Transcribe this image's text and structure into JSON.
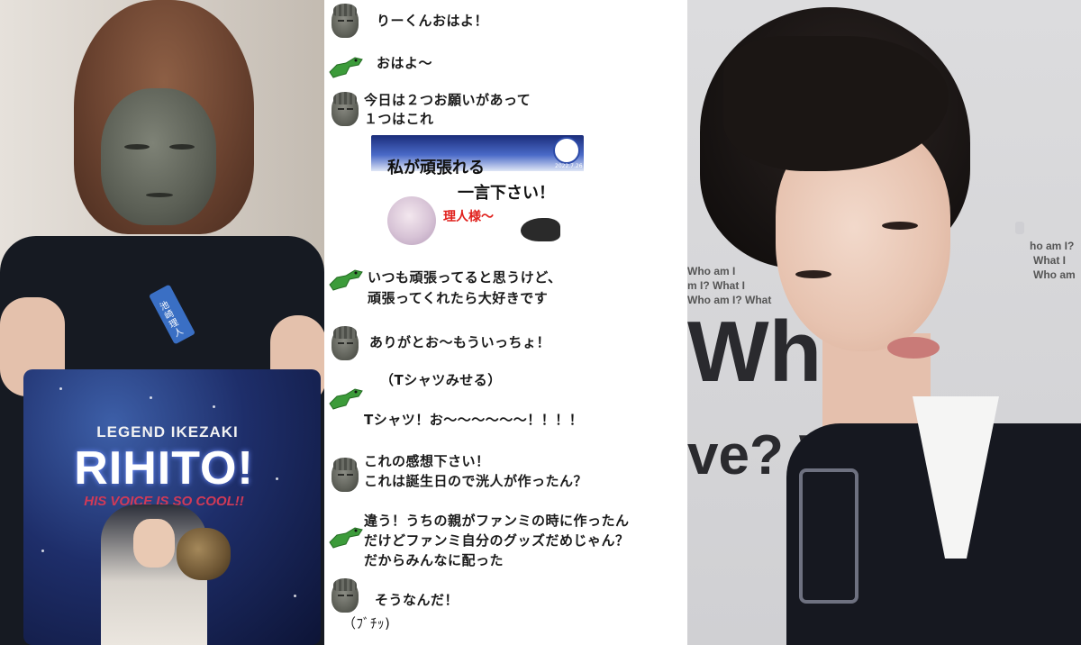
{
  "left_photo": {
    "shirt_legend": "LEGEND IKEZAKI",
    "shirt_name": "RIHITO!",
    "shirt_tagline": "HIS VOICE IS SO COOL!!",
    "name_tag": "池崎理人"
  },
  "chat": {
    "messages": [
      {
        "speaker": "buddha-icon",
        "lines": [
          "りーくんおはよ！"
        ]
      },
      {
        "speaker": "crocodile-icon",
        "lines": [
          "おはよ～"
        ]
      },
      {
        "speaker": "buddha-icon",
        "lines": [
          "今日は２つお願いがあって",
          "１つはこれ"
        ]
      },
      {
        "speaker": "crocodile-icon",
        "lines": [
          "いつも頑張ってると思うけど、",
          "頑張ってくれたら大好きです"
        ]
      },
      {
        "speaker": "buddha-icon",
        "lines": [
          "ありがとお～もういっちょ！"
        ]
      },
      {
        "speaker": "crocodile-icon",
        "lines": [
          "（Tシャツみせる）",
          "Tシャツ！お～～～～～～！！！！"
        ]
      },
      {
        "speaker": "buddha-icon",
        "lines": [
          "これの感想下さい！",
          "これは誕生日ので洸人が作ったん？"
        ]
      },
      {
        "speaker": "crocodile-icon",
        "lines": [
          "違う！うちの親がファンミの時に作ったん",
          "だけどファンミ自分のグッズだめじゃん？",
          "だからみんなに配った"
        ]
      },
      {
        "speaker": "buddha-icon",
        "lines": [
          "そうなんだ！",
          "（ﾌﾞﾁｯ)"
        ]
      }
    ],
    "sticker": {
      "line1": "私が頑張れる",
      "line2": "一言下さい！",
      "name": "理人様～",
      "date": "2022.7.26"
    }
  },
  "right_photo": {
    "bg_text_large_1": "Whe",
    "bg_text_large_2": "ve? Who",
    "bg_text_small_1": "Who am I",
    "bg_text_small_2": "m I? What I",
    "bg_text_small_3": "Who am I? What",
    "bg_text_small_4": "ho am I?",
    "bg_text_small_5": "What I",
    "bg_text_small_6": "Who am"
  },
  "colors": {
    "chat_text": "#1a1a1a",
    "sticker_name": "#e0201c",
    "shirt_tagline": "#d13a57"
  }
}
